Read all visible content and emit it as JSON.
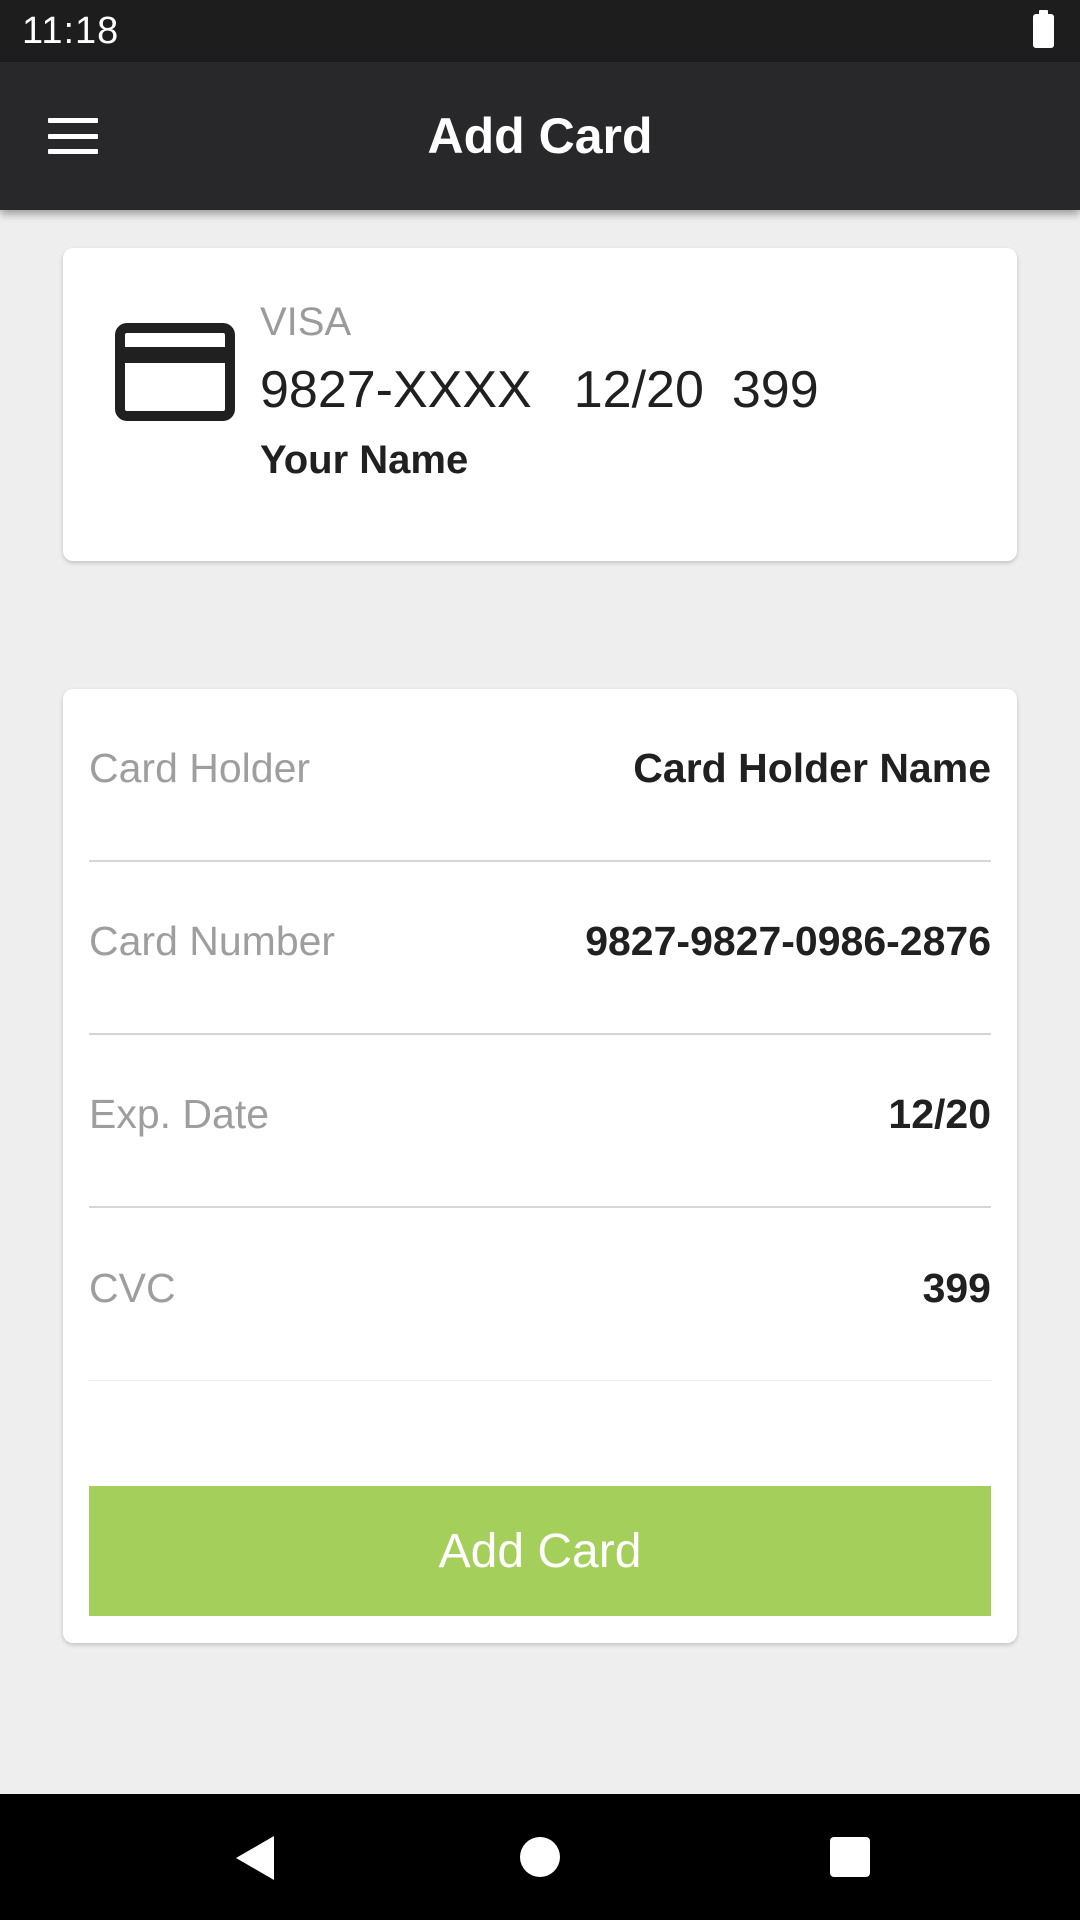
{
  "status_bar": {
    "time": "11:18",
    "battery_icon": "battery-full-icon"
  },
  "app_bar": {
    "title": "Add Card",
    "menu_icon": "hamburger-menu-icon"
  },
  "preview": {
    "icon": "credit-card-icon",
    "brand": "VISA",
    "number": "9827-XXXX",
    "expiry": "12/20",
    "cvc": "399",
    "name": "Your Name"
  },
  "form": {
    "fields": [
      {
        "label": "Card Holder",
        "value": "Card Holder Name"
      },
      {
        "label": "Card Number",
        "value": "9827-9827-0986-2876"
      },
      {
        "label": "Exp. Date",
        "value": "12/20"
      },
      {
        "label": "CVC",
        "value": "399"
      }
    ],
    "submit_label": "Add Card",
    "submit_color": "#a5cf5b"
  },
  "nav_bar": {
    "back_icon": "back-triangle-icon",
    "home_icon": "home-circle-icon",
    "recents_icon": "recents-square-icon"
  }
}
